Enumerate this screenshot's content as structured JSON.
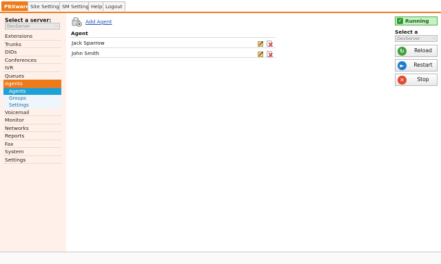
{
  "topnav": {
    "tabs": [
      "PBXware",
      "Site Settings",
      "SM Settings",
      "Help",
      "Logout"
    ]
  },
  "sidebar": {
    "server_label": "Select a server:",
    "server_value": "DevServer",
    "menu": [
      "Extensions",
      "Trunks",
      "DIDs",
      "Conferences",
      "IVR",
      "Queues",
      "Agents"
    ],
    "agents_sub": [
      "Agents",
      "Groups",
      "Settings"
    ],
    "menu_after": [
      "Voicemail",
      "Monitor",
      "Networks",
      "Reports",
      "Fax",
      "System",
      "Settings"
    ]
  },
  "main": {
    "add_label": "Add Agent",
    "column_header": "Agent",
    "rows": [
      "Jack Sparrow",
      "John Smith"
    ]
  },
  "right": {
    "status": "Running",
    "server_label": "Select a server:",
    "server_value": "DevServer",
    "buttons": [
      "Reload",
      "Restart",
      "Stop"
    ]
  },
  "colors": {
    "accent": "#ef7a1a",
    "submenu_active": "#1fa0d6",
    "running": "#2e9d2e"
  }
}
